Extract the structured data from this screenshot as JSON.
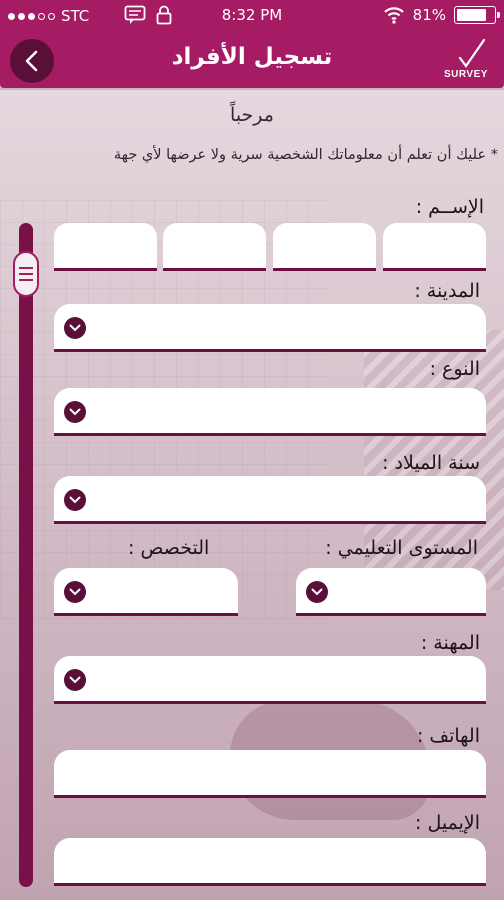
{
  "status_bar": {
    "carrier": "STC",
    "time": "8:32 PM",
    "battery_text": "81%",
    "battery_level": 0.81
  },
  "header": {
    "title": "تسجيل الأفراد",
    "logo_text": "SURVEY",
    "back_icon": "chevron-left-icon"
  },
  "welcome": "مرحباً",
  "notice": "* عليك أن تعلم أن معلوماتك الشخصية سرية ولا عرضها لأي جهة",
  "form": {
    "name_label": "الإســم :",
    "city_label": "المدينة :",
    "gender_label": "النوع :",
    "birth_year_label": "سنة الميلاد :",
    "education_label": "المستوى التعليمي :",
    "specialization_label": "التخصص :",
    "profession_label": "المهنة :",
    "phone_label": "الهاتف :",
    "email_label": "الإيميل :"
  },
  "colors": {
    "primary": "#a51c64",
    "dark": "#5a0f38",
    "underline": "#6a0f3e"
  }
}
